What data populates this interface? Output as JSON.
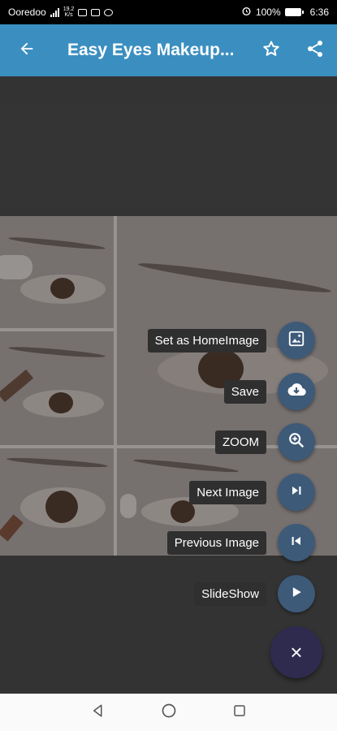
{
  "status_bar": {
    "carrier": "Ooredoo",
    "network": "4G",
    "speed_value": "19.2",
    "speed_unit": "K/s",
    "battery": "100%",
    "time": "6:36"
  },
  "app_bar": {
    "title": "Easy Eyes Makeup...",
    "icons": [
      "arrow-back-icon",
      "star-outline-icon",
      "share-icon"
    ],
    "color": "#3b8fc0"
  },
  "speed_dial": {
    "items": [
      {
        "label": "Set as HomeImage",
        "icon": "wallpaper-icon"
      },
      {
        "label": "Save",
        "icon": "cloud-download-icon"
      },
      {
        "label": "ZOOM",
        "icon": "zoom-in-icon"
      },
      {
        "label": "Next Image",
        "icon": "skip-next-icon"
      },
      {
        "label": "Previous Image",
        "icon": "skip-previous-icon"
      },
      {
        "label": "SlideShow",
        "icon": "play-icon"
      }
    ],
    "close_label": "×",
    "mini_fab_color": "#3d5a78",
    "main_fab_color": "#2e2b4f"
  },
  "nav_bar": {
    "buttons": [
      "back-triangle-icon",
      "home-circle-icon",
      "recents-square-icon"
    ]
  }
}
